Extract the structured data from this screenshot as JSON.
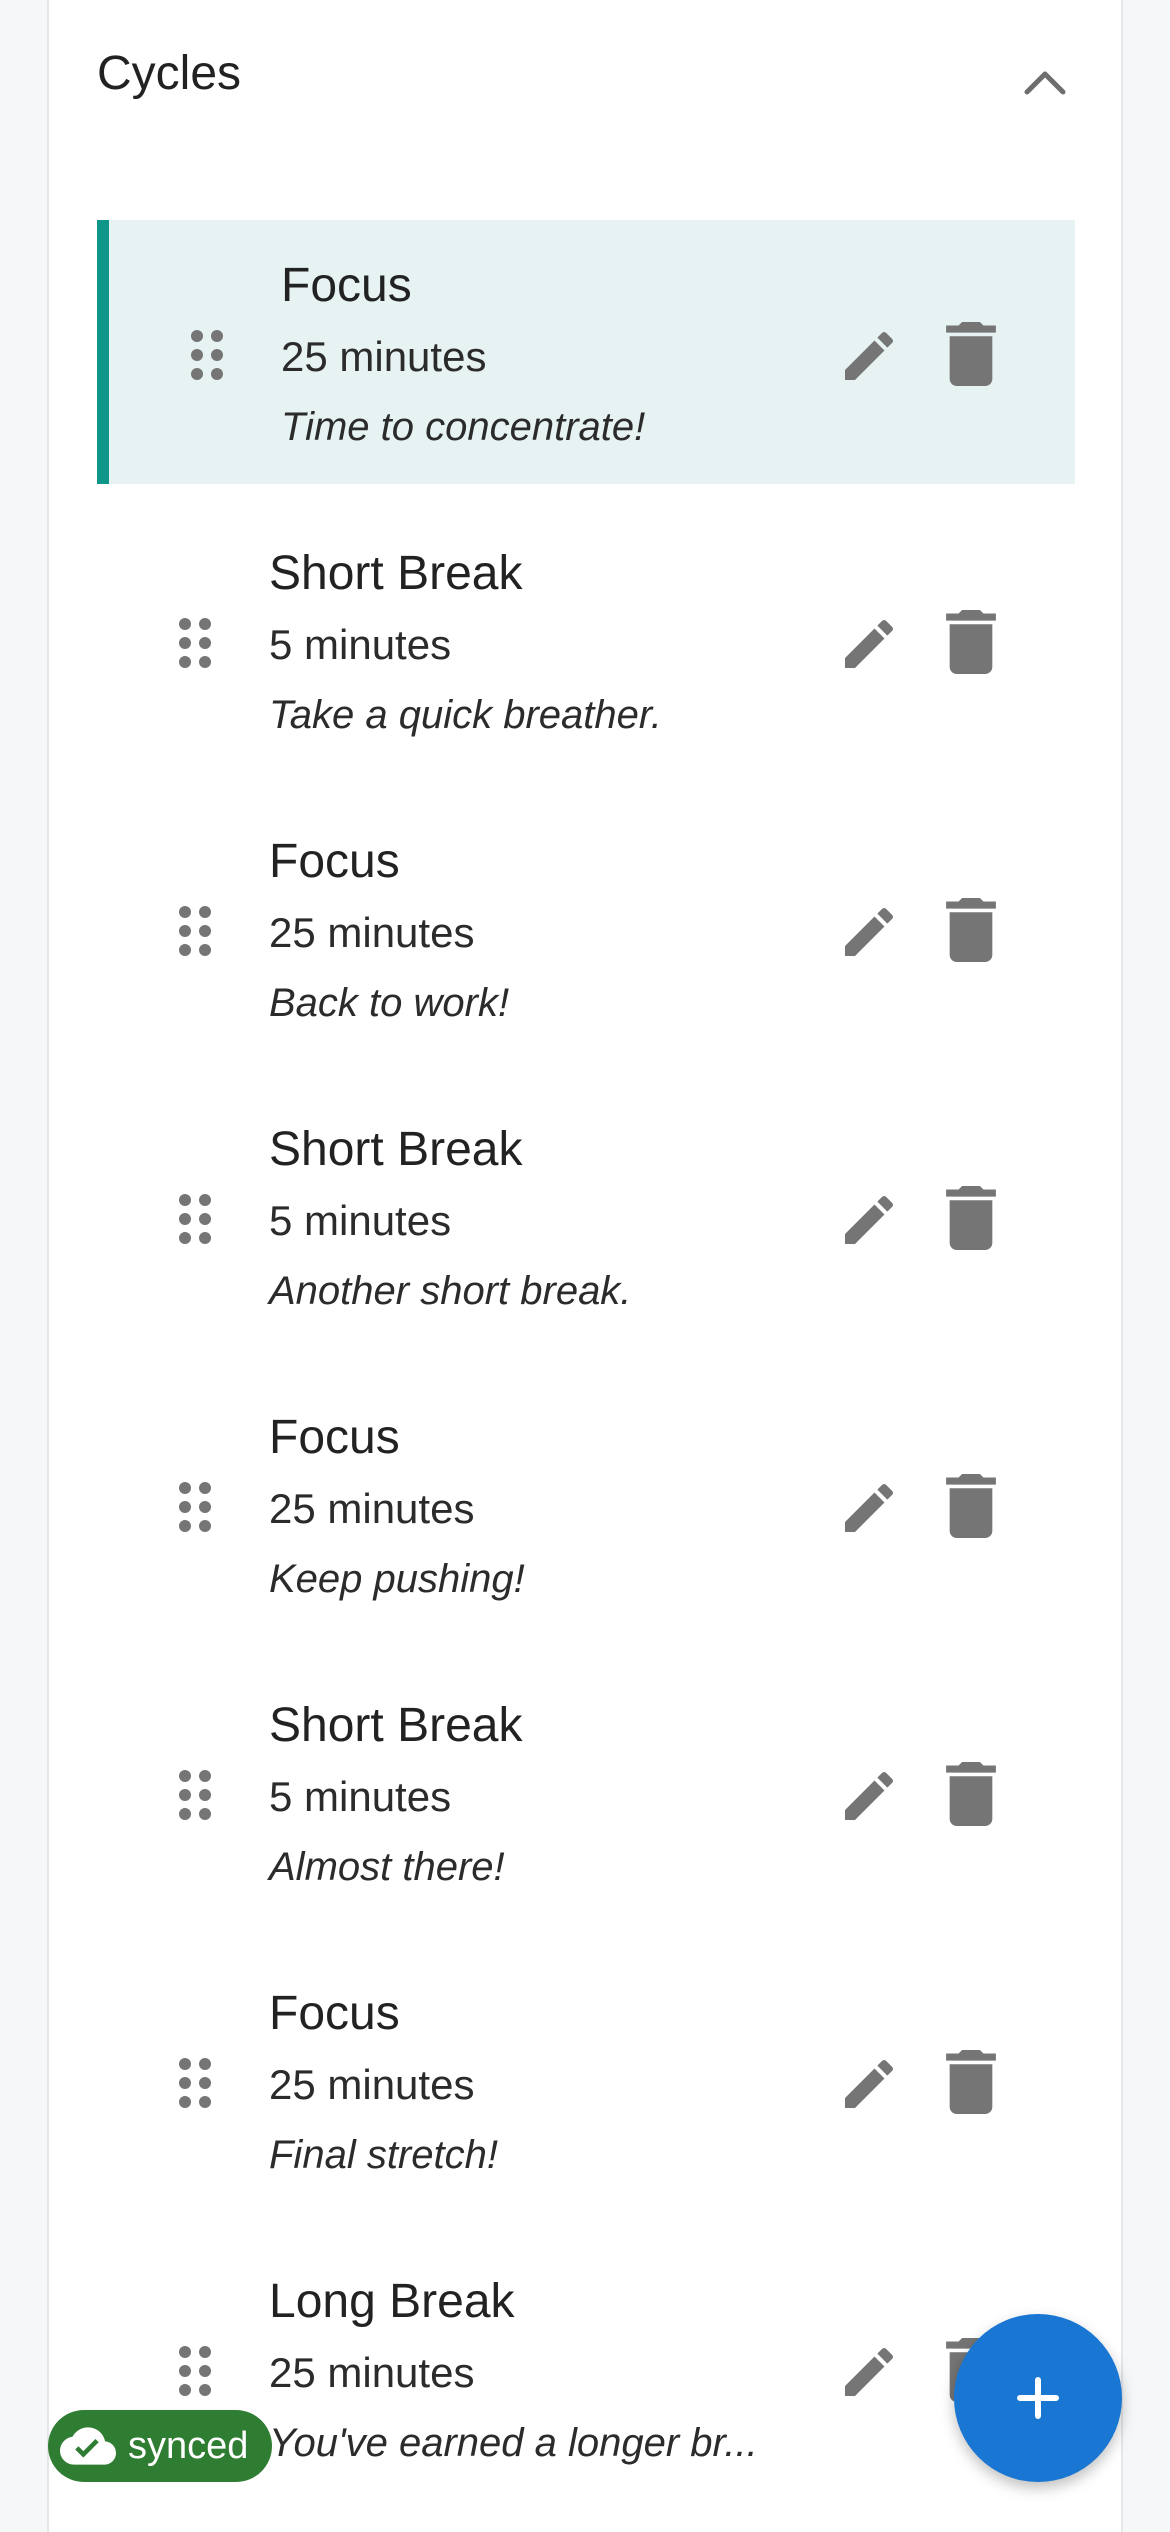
{
  "section": {
    "title": "Cycles",
    "collapse_icon": "chevron-up-icon"
  },
  "cycles": [
    {
      "name": "Focus",
      "duration": "25 minutes",
      "message": "Time to concentrate!",
      "active": true
    },
    {
      "name": "Short Break",
      "duration": "5 minutes",
      "message": "Take a quick breather.",
      "active": false
    },
    {
      "name": "Focus",
      "duration": "25 minutes",
      "message": "Back to work!",
      "active": false
    },
    {
      "name": "Short Break",
      "duration": "5 minutes",
      "message": "Another short break.",
      "active": false
    },
    {
      "name": "Focus",
      "duration": "25 minutes",
      "message": "Keep pushing!",
      "active": false
    },
    {
      "name": "Short Break",
      "duration": "5 minutes",
      "message": "Almost there!",
      "active": false
    },
    {
      "name": "Focus",
      "duration": "25 minutes",
      "message": "Final stretch!",
      "active": false
    },
    {
      "name": "Long Break",
      "duration": "25 minutes",
      "message": "You've earned a longer br...",
      "active": false
    }
  ],
  "icons": {
    "drag": "drag-handle-icon",
    "edit": "pencil-icon",
    "delete": "trash-icon",
    "add": "plus-icon",
    "sync": "cloud-check-icon"
  },
  "sync_status": {
    "label": "synced"
  },
  "colors": {
    "accent": "#0e9688",
    "active_bg": "#e7f3f3",
    "fab": "#1976d2",
    "sync_badge": "#2e7d32",
    "icon_gray": "#757575"
  }
}
